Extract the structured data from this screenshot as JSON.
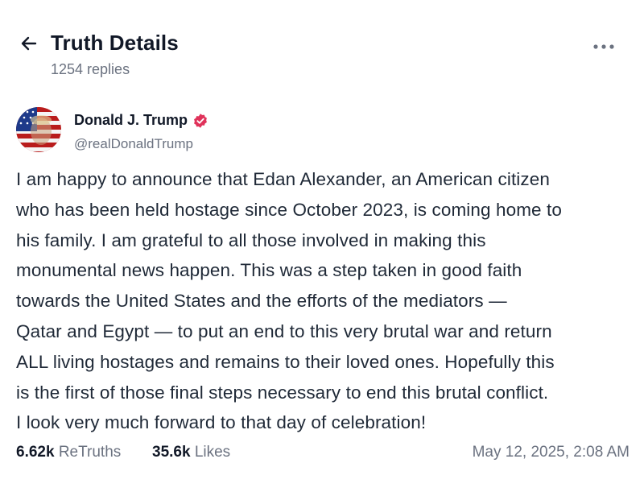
{
  "header": {
    "title": "Truth Details",
    "replies": "1254 replies",
    "back_icon": "arrow-left-icon",
    "more_icon": "more-horizontal-icon"
  },
  "post": {
    "author": {
      "name": "Donald J. Trump",
      "handle": "@realDonaldTrump",
      "verified_icon": "verified-badge-icon",
      "verified_color": "#e0325a"
    },
    "text": "I am happy to announce that Edan Alexander, an American citizen\nwho has been held hostage since October 2023, is coming home to\nhis family. I am grateful to all those involved in making this\nmonumental news happen. This was a step taken in good faith\ntowards the United States and the efforts of the mediators —\nQatar and Egypt — to put an end to this very brutal war and return\nALL living hostages and remains to their loved ones. Hopefully this\nis the first of those final steps necessary to end this brutal conflict.\nI look very much forward to that day of celebration!",
    "stats": {
      "retruths_count": "6.62k",
      "retruths_label": "ReTruths",
      "likes_count": "35.6k",
      "likes_label": "Likes"
    },
    "timestamp": "May 12, 2025, 2:08 AM"
  }
}
